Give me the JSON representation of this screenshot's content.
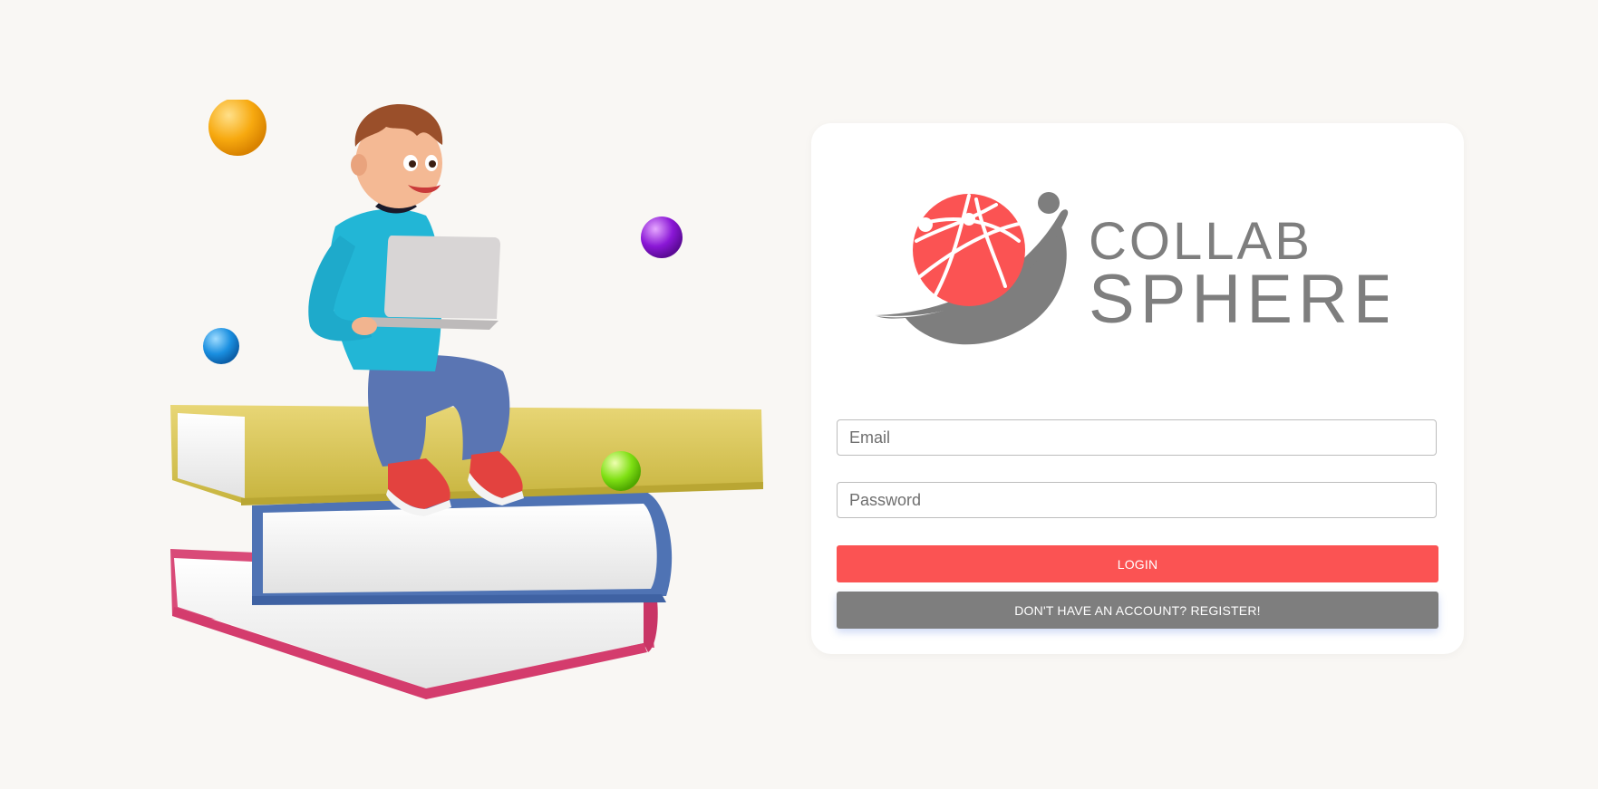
{
  "brand": {
    "name_line1": "COLLAB",
    "name_line2": "SPHERE",
    "primary_color": "#fb5353",
    "secondary_color": "#7e7e7e"
  },
  "form": {
    "email_placeholder": "Email",
    "password_placeholder": "Password",
    "login_label": "LOGIN",
    "register_label": "DON'T HAVE AN ACCOUNT? REGISTER!"
  },
  "illustration": {
    "subject": "student-on-books-with-laptop"
  }
}
